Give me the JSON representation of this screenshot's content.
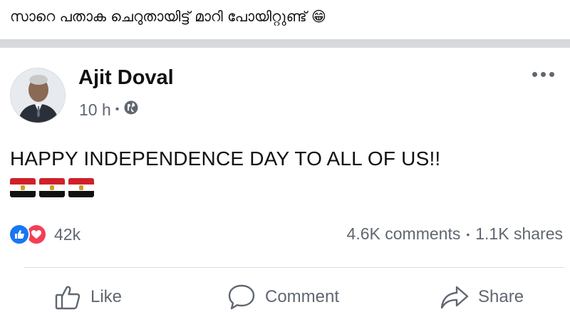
{
  "caption": {
    "text": "സാറെ പതാക ചെറുതായിട്ട് മാറി പോയിറ്റുണ്ട്",
    "emoji": "😁"
  },
  "post": {
    "author": "Ajit Doval",
    "time": "10 h",
    "separator": "•",
    "privacy_icon": "globe-icon",
    "text": "HAPPY INDEPENDENCE DAY TO ALL OF US!!",
    "flags": [
      "egypt-flag",
      "egypt-flag",
      "egypt-flag"
    ],
    "reactions": {
      "types": [
        "like",
        "love"
      ],
      "count": "42k"
    },
    "comments": "4.6K comments",
    "engagement_separator": "•",
    "shares": "1.1K shares"
  },
  "actions": {
    "like_label": "Like",
    "comment_label": "Comment",
    "share_label": "Share"
  },
  "colors": {
    "like_blue": "#1877f2",
    "love_red": "#f33e58",
    "meta_gray": "#606770",
    "divider": "#d6d8dc"
  }
}
